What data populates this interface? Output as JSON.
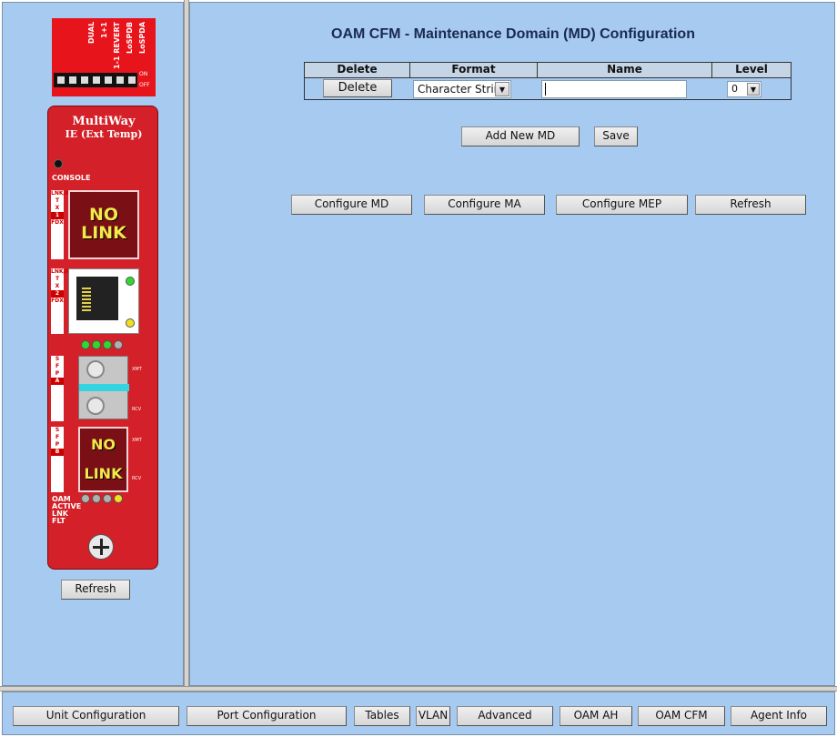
{
  "device": {
    "dip_labels": [
      "LoSPDA",
      "LoSPDB",
      "1-1 REVERT",
      "1+1",
      "DUAL"
    ],
    "dip_on": "ON",
    "dip_off": "OFF",
    "brand": "MultiWay",
    "brand_sub": "IE (Ext Temp)",
    "console_label": "CONSOLE",
    "port1_nolink_a": "NO",
    "port1_nolink_b": "LINK",
    "sfpb_nolink_a": "NO",
    "sfpb_nolink_b": "LINK",
    "oam_label": "OAM",
    "active_label": "ACTIVE",
    "lnk_label": "LNK",
    "flt_label": "FLT",
    "xmt_label": "XMT",
    "rcv_label": "RCV",
    "port_strip_1": [
      "LNK/ACT",
      "T",
      "X",
      "1",
      "FDX"
    ],
    "port_strip_2": [
      "LNK/ACT",
      "T",
      "X",
      "2",
      "FDX"
    ],
    "sfp_strip_a": [
      "S",
      "F",
      "P",
      "A"
    ],
    "sfp_strip_b": [
      "S",
      "F",
      "P",
      "B"
    ],
    "led_colors": {
      "green": "#2ed92e",
      "yellow": "#f2e020",
      "gray": "#b0b0b0"
    }
  },
  "left_refresh": "Refresh",
  "page": {
    "title": "OAM CFM - Maintenance Domain (MD) Configuration"
  },
  "md_table": {
    "headers": {
      "delete": "Delete",
      "format": "Format",
      "name": "Name",
      "level": "Level"
    },
    "row": {
      "delete_button": "Delete",
      "format_value": "Character String",
      "name_value": "",
      "level_value": "0"
    }
  },
  "actions": {
    "add_new": "Add New MD",
    "save": "Save"
  },
  "config_buttons": {
    "configure_md": "Configure MD",
    "configure_ma": "Configure MA",
    "configure_mep": "Configure MEP",
    "refresh": "Refresh"
  },
  "bottom_nav": {
    "unit_config": "Unit Configuration",
    "port_config": "Port Configuration",
    "tables": "Tables",
    "vlan": "VLAN",
    "advanced": "Advanced",
    "oam_ah": "OAM AH",
    "oam_cfm": "OAM CFM",
    "agent_info": "Agent Info"
  },
  "colors": {
    "frame_bg": "#a6caf0",
    "device_red": "#d42028",
    "title_text": "#1a2a52"
  }
}
